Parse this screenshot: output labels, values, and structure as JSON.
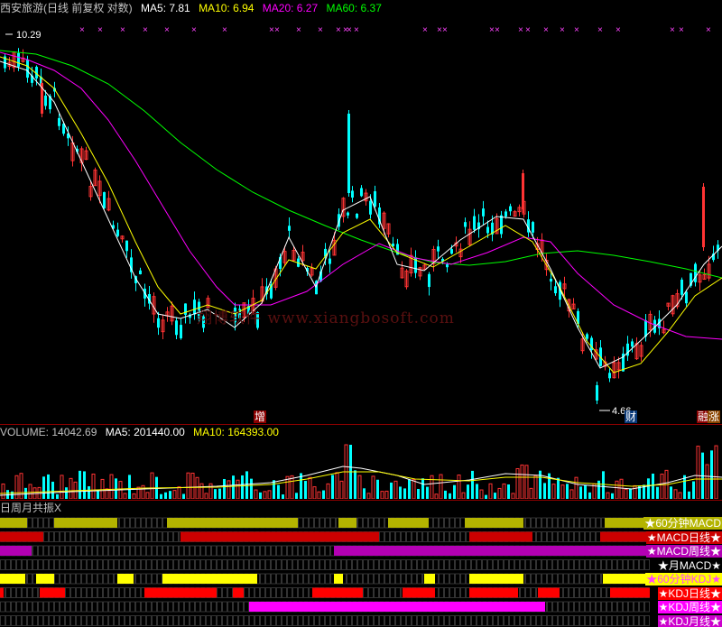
{
  "price_panel": {
    "header": {
      "title": "西安旅游(日线 前复权 对数)",
      "ma5": "MA5: 7.81",
      "ma10": "MA10: 6.94",
      "ma20": "MA20: 6.27",
      "ma60": "MA60: 6.37"
    },
    "high_label": "10.29",
    "low_label": "4.66",
    "badge_zeng": "增",
    "badge_cai": "财",
    "badge_rong": "融",
    "badge_zhang": "涨",
    "watermark": "翔博软件 www.xiangbosoft.com"
  },
  "volume_panel": {
    "header": {
      "volume": "VOLUME: 14042.69",
      "ma5": "MA5: 201440.00",
      "ma10": "MA10: 164393.00"
    }
  },
  "resonance_panel": {
    "title": "日周月共振X",
    "rows": [
      {
        "label": "★60分钟MACD",
        "color": "#b4b400",
        "label_color": "#ffffff"
      },
      {
        "label": "★MACD日线★",
        "color": "#cc0000",
        "label_color": "#ffffff"
      },
      {
        "label": "★MACD周线★",
        "color": "#b400b4",
        "label_color": "#ffffff"
      },
      {
        "label": "★月MACD★",
        "color": "#dddddd",
        "label_color": "#ffffff"
      },
      {
        "label": "★60分钟KDJ★",
        "color": "#ffff00",
        "label_color": "#ff44ff"
      },
      {
        "label": "★KDJ日线★",
        "color": "#ff0000",
        "label_color": "#ffffff"
      },
      {
        "label": "★KDJ周线★",
        "color": "#ff00ff",
        "label_color": "#ffffff"
      },
      {
        "label": "★KDJ月线★",
        "color": "#cc00cc",
        "label_color": "#ffffff"
      }
    ]
  },
  "colors": {
    "up": "#ff3333",
    "down": "#00ffff",
    "ma5": "#ffffff",
    "ma10": "#ffff00",
    "ma20": "#ff00ff",
    "ma60": "#00ff00",
    "grid": "#8b0000"
  }
}
